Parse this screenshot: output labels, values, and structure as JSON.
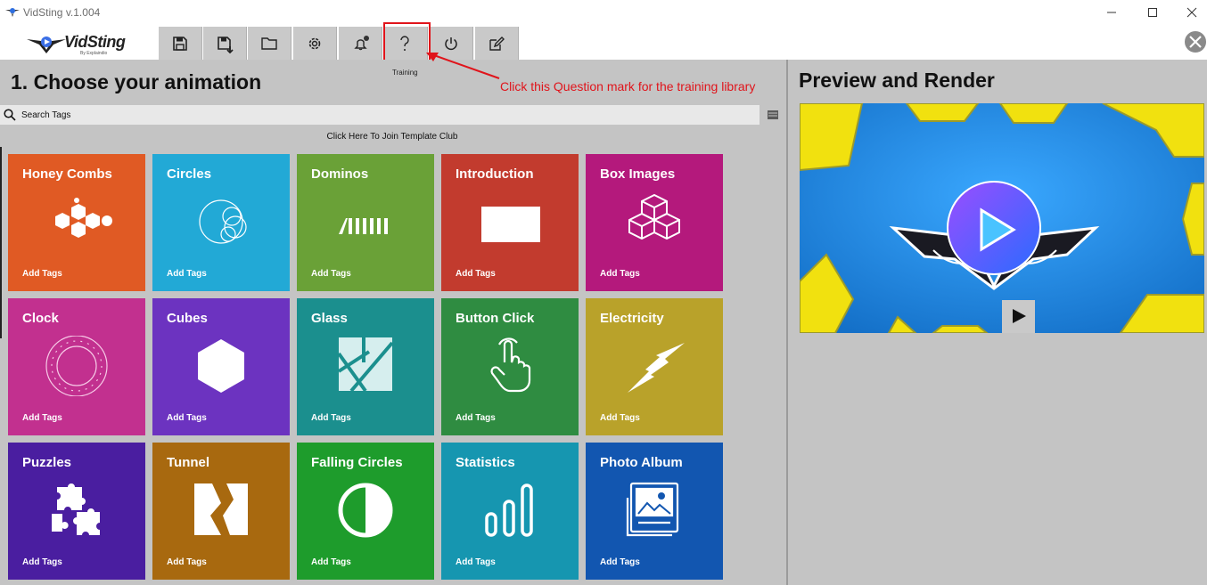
{
  "window": {
    "title": "VidSting v.1.004",
    "controls": [
      "minimize-icon",
      "maximize-icon",
      "close-icon"
    ]
  },
  "logo": {
    "text": "VidSting",
    "subtitle": "By Explaindio"
  },
  "toolbar": {
    "buttons": [
      {
        "name": "save",
        "icon": "save-icon"
      },
      {
        "name": "save-as",
        "icon": "save-as-icon"
      },
      {
        "name": "open",
        "icon": "folder-icon"
      },
      {
        "name": "settings",
        "icon": "gear-icon"
      },
      {
        "name": "notifications",
        "icon": "bell-icon"
      },
      {
        "name": "training",
        "icon": "question-icon",
        "label": "Training"
      },
      {
        "name": "power",
        "icon": "power-icon"
      },
      {
        "name": "edit",
        "icon": "edit-icon"
      }
    ],
    "highlight_color": "#e0141b"
  },
  "left": {
    "heading": "1. Choose your animation",
    "annotation": "Click this Question mark for the training library",
    "search_placeholder": "Search Tags",
    "club_link": "Click Here To Join Template Club"
  },
  "templates": [
    {
      "name": "Honey Combs",
      "tags": "Add Tags",
      "color": "#e05a24",
      "icon": "honeycomb-icon"
    },
    {
      "name": "Circles",
      "tags": "Add Tags",
      "color": "#22a9d6",
      "icon": "circles-icon"
    },
    {
      "name": "Dominos",
      "tags": "Add Tags",
      "color": "#6aa137",
      "icon": "dominos-icon"
    },
    {
      "name": "Introduction",
      "tags": "Add Tags",
      "color": "#c23b2e",
      "icon": "rectangle-icon"
    },
    {
      "name": "Box Images",
      "tags": "Add Tags",
      "color": "#b4197c",
      "icon": "boxes-icon"
    },
    {
      "name": "Clock",
      "tags": "Add Tags",
      "color": "#c2308f",
      "icon": "clock-icon"
    },
    {
      "name": "Cubes",
      "tags": "Add Tags",
      "color": "#6c33c0",
      "icon": "hexagon-icon"
    },
    {
      "name": "Glass",
      "tags": "Add Tags",
      "color": "#1b8f8e",
      "icon": "glass-icon"
    },
    {
      "name": "Button Click",
      "tags": "Add Tags",
      "color": "#2f8c41",
      "icon": "hand-click-icon"
    },
    {
      "name": "Electricity",
      "tags": "Add Tags",
      "color": "#b9a22a",
      "icon": "lightning-icon"
    },
    {
      "name": "Puzzles",
      "tags": "Add Tags",
      "color": "#4a1ea0",
      "icon": "puzzle-icon"
    },
    {
      "name": "Tunnel",
      "tags": "Add Tags",
      "color": "#a8690f",
      "icon": "tunnel-icon"
    },
    {
      "name": "Falling Circles",
      "tags": "Add Tags",
      "color": "#1e9c2c",
      "icon": "half-circle-icon"
    },
    {
      "name": "Statistics",
      "tags": "Add Tags",
      "color": "#1696b0",
      "icon": "bar-chart-icon"
    },
    {
      "name": "Photo Album",
      "tags": "Add Tags",
      "color": "#1256b0",
      "icon": "photo-album-icon"
    }
  ],
  "right": {
    "title": "Preview and Render",
    "preview_bg": "#1f8fe6",
    "preview_accent": "#f1e10f",
    "play_icon": "play-icon"
  }
}
